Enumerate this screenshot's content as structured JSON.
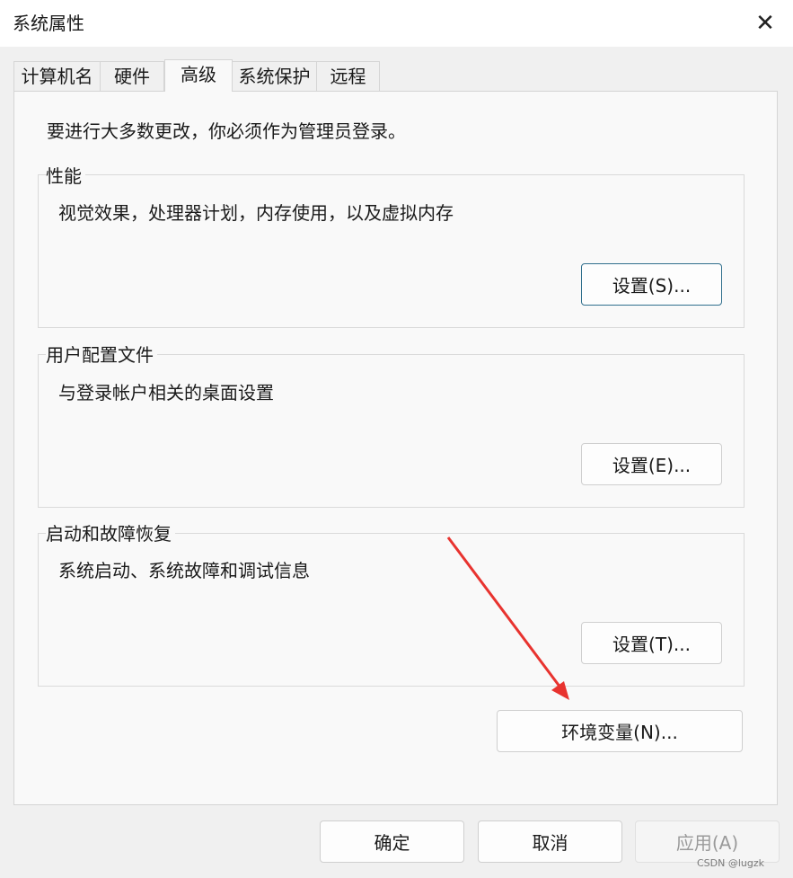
{
  "window": {
    "title": "系统属性",
    "close_glyph": "✕"
  },
  "tabs": [
    {
      "label": "计算机名",
      "active": false
    },
    {
      "label": "硬件",
      "active": false
    },
    {
      "label": "高级",
      "active": true
    },
    {
      "label": "系统保护",
      "active": false
    },
    {
      "label": "远程",
      "active": false
    }
  ],
  "advanced": {
    "admin_note": "要进行大多数更改，你必须作为管理员登录。",
    "performance": {
      "title": "性能",
      "description": "视觉效果，处理器计划，内存使用，以及虚拟内存",
      "button": "设置(S)..."
    },
    "user_profiles": {
      "title": "用户配置文件",
      "description": "与登录帐户相关的桌面设置",
      "button": "设置(E)..."
    },
    "startup_recovery": {
      "title": "启动和故障恢复",
      "description": "系统启动、系统故障和调试信息",
      "button": "设置(T)..."
    },
    "env_button": "环境变量(N)..."
  },
  "footer": {
    "ok": "确定",
    "cancel": "取消",
    "apply": "应用(A)"
  },
  "watermark": "CSDN @lugzk",
  "colors": {
    "arrow": "#e8332f",
    "default_button_border": "#2f6e8c"
  }
}
